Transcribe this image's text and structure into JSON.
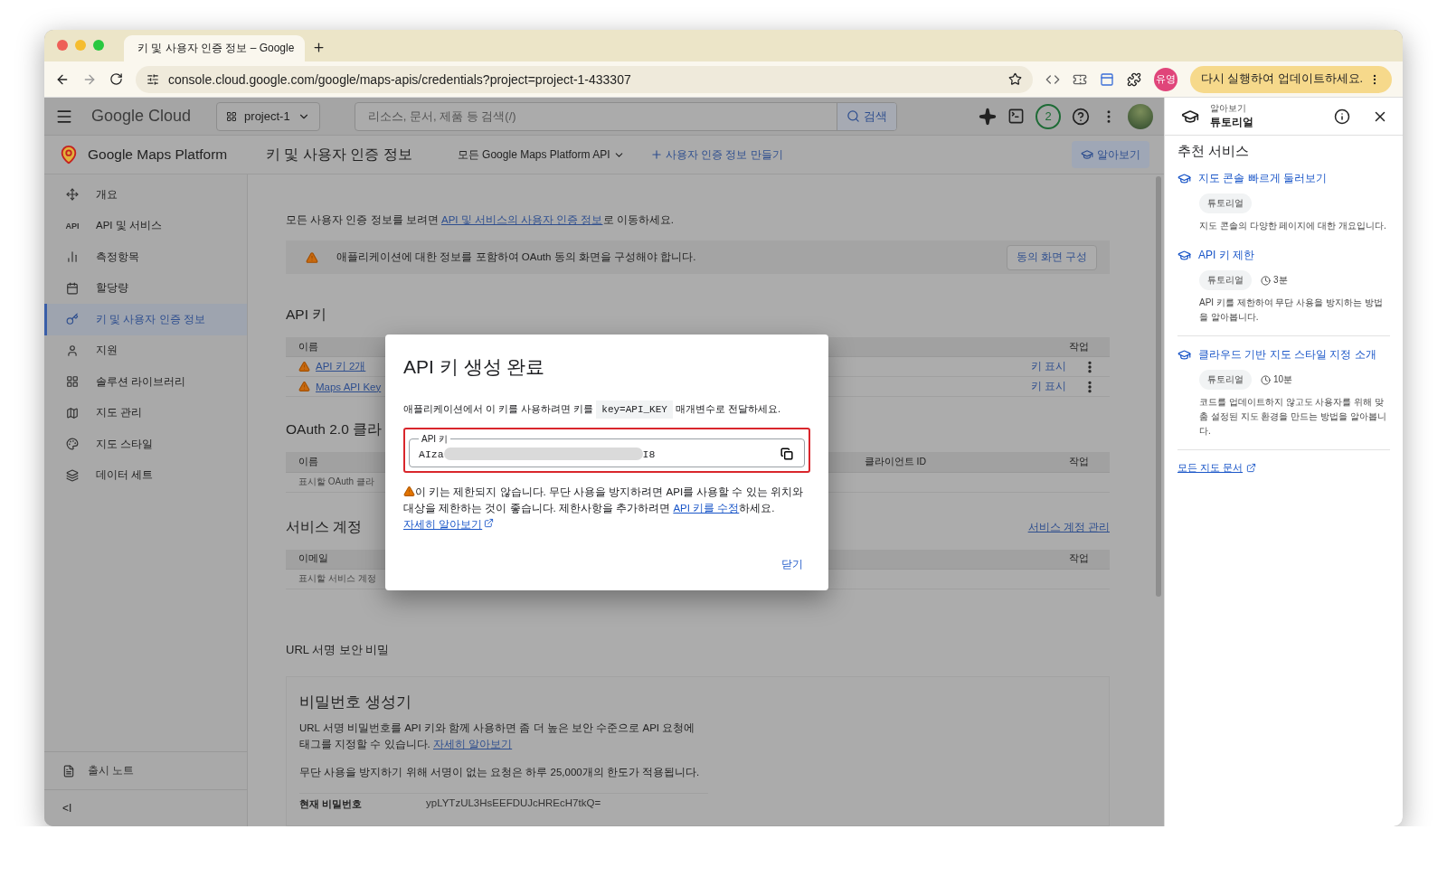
{
  "browser": {
    "tab_title": "키 및 사용자 인증 정보 – Google",
    "url": "console.cloud.google.com/google/maps-apis/credentials?project=project-1-433307",
    "profile_badge": "유영",
    "update_button": "다시 실행하여 업데이트하세요."
  },
  "header": {
    "logo": "Google Cloud",
    "project": "project-1",
    "search_placeholder": "리소스, 문서, 제품 등 검색(/)",
    "search_button": "검색",
    "notifications": "2"
  },
  "product": {
    "name": "Google Maps Platform",
    "page_title": "키 및 사용자 인증 정보",
    "api_filter": "모든 Google Maps Platform API",
    "create_button": "사용자 인증 정보 만들기",
    "learn_button": "알아보기"
  },
  "sidebar": {
    "items": [
      {
        "label": "개요",
        "selected": false
      },
      {
        "label": "API 및 서비스",
        "badge": "API",
        "selected": false
      },
      {
        "label": "측정항목",
        "selected": false
      },
      {
        "label": "할당량",
        "selected": false
      },
      {
        "label": "키 및 사용자 인증 정보",
        "selected": true
      },
      {
        "label": "지원",
        "selected": false
      },
      {
        "label": "솔루션 라이브러리",
        "selected": false
      },
      {
        "label": "지도 관리",
        "selected": false
      },
      {
        "label": "지도 스타일",
        "selected": false
      },
      {
        "label": "데이터 세트",
        "selected": false
      }
    ],
    "footer_item": "출시 노트",
    "collapse": "<I"
  },
  "main": {
    "notice": {
      "before": "모든 사용자 인증 정보를 보려면 ",
      "link": "API 및 서비스의 사용자 인증 정보",
      "after": "로 이동하세요."
    },
    "warning_banner": {
      "text": "애플리케이션에 대한 정보를 포함하여 OAuth 동의 화면을 구성해야 합니다.",
      "button": "동의 화면 구성"
    },
    "api_keys": {
      "title": "API 키",
      "columns": [
        "이름",
        "작업"
      ],
      "rows": [
        {
          "name": "API 키 2개",
          "action": "키 표시"
        },
        {
          "name": "Maps API Key",
          "action": "키 표시"
        }
      ]
    },
    "oauth": {
      "title": "OAuth 2.0 클라",
      "columns": [
        "이름",
        "클라이언트 ID",
        "작업"
      ],
      "empty": "표시할 OAuth 클라"
    },
    "service_accounts": {
      "title": "서비스 계정",
      "manage_link": "서비스 계정 관리",
      "columns": [
        "이메일",
        "작업"
      ],
      "empty": "표시할 서비스 계정"
    },
    "url_signing": {
      "title": "URL 서명 보안 비밀",
      "card_title": "비밀번호 생성기",
      "description": "URL 서명 비밀번호를 API 키와 함께 사용하면 좀 더 높은 보안 수준으로 API 요청에 태그를 지정할 수 있습니다. ",
      "description_link": "자세히 알아보기",
      "limit_text": "무단 사용을 방지하기 위해 서명이 없는 요청은 하루 25,000개의 한도가 적용됩니다.",
      "secret_label": "현재 비밀번호",
      "secret_value": "ypLYTzUL3HsEEFDUJcHREcH7tkQ="
    }
  },
  "dialog": {
    "title": "API 키 생성 완료",
    "instruction_before": "애플리케이션에서 이 키를 사용하려면 키를 ",
    "instruction_code": "key=API_KEY",
    "instruction_after": " 매개변수로 전달하세요.",
    "field_label": "API 키",
    "key_prefix": "AIza",
    "key_suffix": "I8",
    "warning_before": "이 키는 제한되지 않습니다. 무단 사용을 방지하려면 API를 사용할 수 있는 위치와 대상을 제한하는 것이 좋습니다. 제한사항을 추가하려면 ",
    "warning_link": "API 키를 수정",
    "warning_after": "하세요. ",
    "learn_link": "자세히 알아보기",
    "close_button": "닫기"
  },
  "side_panel": {
    "eyebrow": "알아보기",
    "title": "튜토리얼",
    "section_title": "추천 서비스",
    "items": [
      {
        "title": "지도 콘솔 빠르게 둘러보기",
        "tag": "튜토리얼",
        "description": "지도 콘솔의 다양한 페이지에 대한 개요입니다."
      },
      {
        "title": "API 키 제한",
        "tag": "튜토리얼",
        "duration": "3분",
        "description": "API 키를 제한하여 무단 사용을 방지하는 방법을 알아봅니다."
      },
      {
        "title": "클라우드 기반 지도 스타일 지정 소개",
        "tag": "튜토리얼",
        "duration": "10분",
        "description": "코드를 업데이트하지 않고도 사용자를 위해 맞춤 설정된 지도 환경을 만드는 방법을 알아봅니다."
      }
    ],
    "all_docs_link": "모든 지도 문서"
  }
}
